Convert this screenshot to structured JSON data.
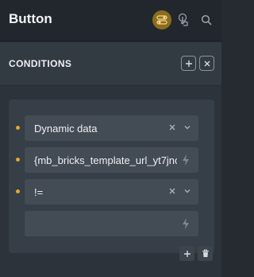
{
  "header": {
    "title": "Button",
    "icons": [
      "toggle-icon",
      "pointer-icon",
      "search-icon"
    ]
  },
  "conditions": {
    "title": "CONDITIONS",
    "rows": [
      {
        "value": "Dynamic data",
        "type": "select"
      },
      {
        "value": "{mb_bricks_template_url_yt7jnc",
        "type": "dynamic"
      },
      {
        "value": "!=",
        "type": "select"
      },
      {
        "value": "",
        "type": "dynamic"
      }
    ]
  },
  "colors": {
    "accent": "#e0a92c",
    "panel_bg": "#2c333a",
    "header_bg": "#22272d",
    "field_bg": "#434b55"
  }
}
